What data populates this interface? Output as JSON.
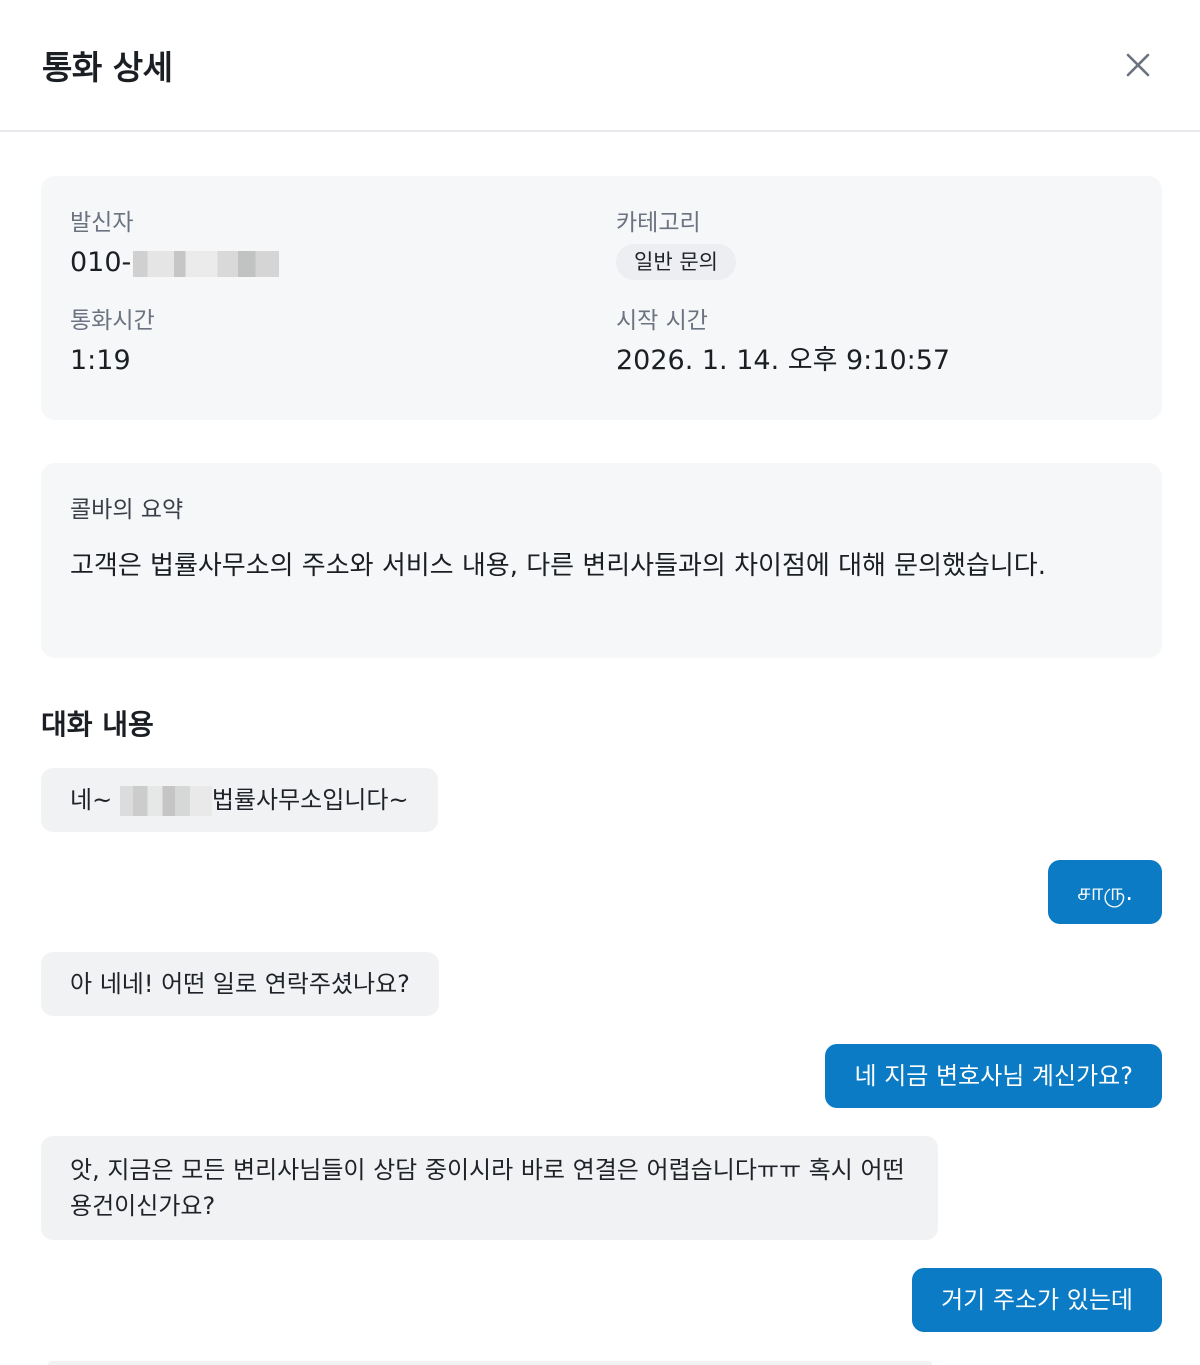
{
  "header": {
    "title": "통화 상세"
  },
  "info": {
    "caller_label": "발신자",
    "caller_value": "010-",
    "category_label": "카테고리",
    "category_badge": "일반 문의",
    "duration_label": "통화시간",
    "duration_value": "1:19",
    "start_label": "시작 시간",
    "start_value": "2026. 1. 14. 오후 9:10:57"
  },
  "summary": {
    "label": "콜바의 요약",
    "text": "고객은 법률사무소의 주소와 서비스 내용, 다른 변리사들과의 차이점에 대해 문의했습니다."
  },
  "conversation": {
    "title": "대화 내용",
    "messages": [
      {
        "side": "left",
        "prefix": "네~ ",
        "text": "법률사무소입니다~"
      },
      {
        "side": "right",
        "text": "சாரு."
      },
      {
        "side": "left",
        "text": "아 네네! 어떤 일로 연락주셨나요?"
      },
      {
        "side": "right",
        "text": "네 지금 변호사님 계신가요?"
      },
      {
        "side": "left",
        "text": "앗, 지금은 모든 변리사님들이 상담 중이시라 바로 연결은 어렵습니다ㅠㅠ 혹시 어떤 용건이신가요?"
      },
      {
        "side": "right",
        "text": "거기 주소가 있는데"
      }
    ]
  }
}
